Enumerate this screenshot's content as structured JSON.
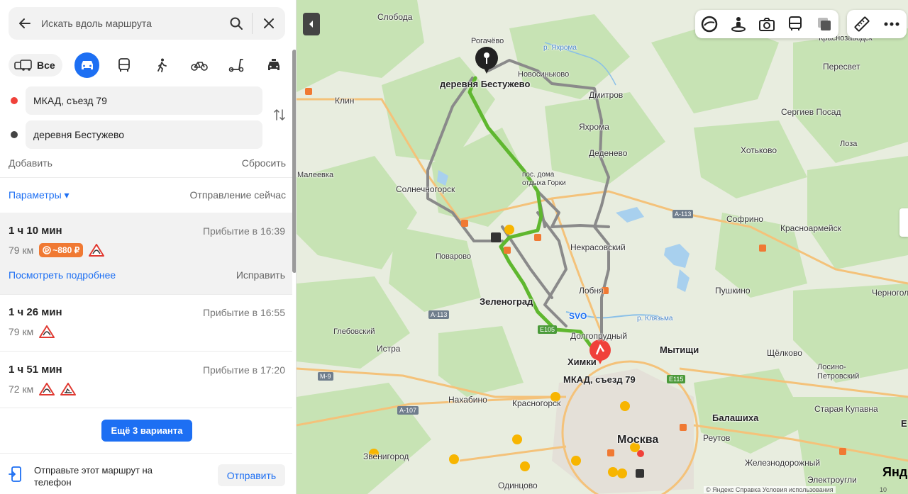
{
  "search": {
    "placeholder": "Искать вдоль маршрута"
  },
  "modes": {
    "all_label": "Все"
  },
  "points": {
    "from": "МКАД, съезд 79",
    "to": "деревня Бестужево"
  },
  "actions": {
    "add": "Добавить",
    "reset": "Сбросить"
  },
  "params": {
    "label": "Параметры ▾",
    "departure": "Отправление сейчас"
  },
  "routes": [
    {
      "time": "1 ч 10 мин",
      "arrival": "Прибытие в 16:39",
      "distance": "79 км",
      "toll": "~880 ₽",
      "details": "Посмотреть подробнее",
      "edit": "Исправить"
    },
    {
      "time": "1 ч 26 мин",
      "arrival": "Прибытие в 16:55",
      "distance": "79 км"
    },
    {
      "time": "1 ч 51 мин",
      "arrival": "Прибытие в 17:20",
      "distance": "72 км"
    }
  ],
  "more_variants": "Ещё 3 варианта",
  "send": {
    "text": "Отправьте этот маршрут на телефон",
    "button": "Отправить"
  },
  "colors": {
    "accent": "#1d6ff3",
    "route_main": "#5fb72f",
    "route_alt": "#8a8a8a",
    "toll": "#f07933",
    "start": "#f0413a"
  },
  "map": {
    "labels": {
      "sloboda": "Слобода",
      "rogachevo": "Рогачёво",
      "bestuzhevo": "деревня Бестужево",
      "novosinkovo": "Новосинько­во",
      "yakhroma_river": "р. Яхрома",
      "klin": "Клин",
      "dmitrov": "Дмитров",
      "yakhroma": "Яхрома",
      "dedenevo": "Деденево",
      "krasnozavodsk": "Краснозаводск",
      "peresvet": "Пересвет",
      "sergiev_posad": "Сергиев Посад",
      "khotkovo": "Хотьково",
      "loza": "Лоза",
      "maleevka": "Малеевка",
      "gorki": "пос. дома отдыха Горки",
      "solnechnogorsk": "Солнечногорск",
      "a113_1": "A-113",
      "a113_2": "A-113",
      "sofrino": "Софрино",
      "krasnoarmeysk": "Красноармейск",
      "povarovo": "Поварово",
      "nekrasovsky": "Некрасовский",
      "lobnya": "Лобня",
      "pushkino": "Пушкино",
      "chernogolovka": "Черноголо",
      "zelenograd": "Зеленоград",
      "svo": "SVO",
      "klyazma": "р. Клязьма",
      "e105": "E105",
      "dolgoprudny": "Долгопрудный",
      "glebovsky": "Глебовский",
      "istra": "Истра",
      "mytishchi": "Мытищи",
      "shchelkovo": "Щёлково",
      "khimki": "Химки",
      "mkad79": "МКАД, съезд 79",
      "losino": "Лосино-Петровский",
      "m9": "M-9",
      "e115": "E115",
      "a107": "A-107",
      "nakhabino": "Нахабино",
      "krasnogorsk": "Красногорск",
      "balashikha": "Балашиха",
      "staraya_kupavna": "Старая Купавна",
      "e": "Е",
      "moskva": "Москва",
      "reutov": "Реутов",
      "zvenigorod": "Звенигород",
      "zheleznodorozhny": "Железнодорожный",
      "elektrougli": "Электроугли",
      "odintsovo": "Одинцово"
    },
    "copyright": "© Яндекс  Справка  Условия использования",
    "logo": "Янд",
    "scale": "10"
  }
}
